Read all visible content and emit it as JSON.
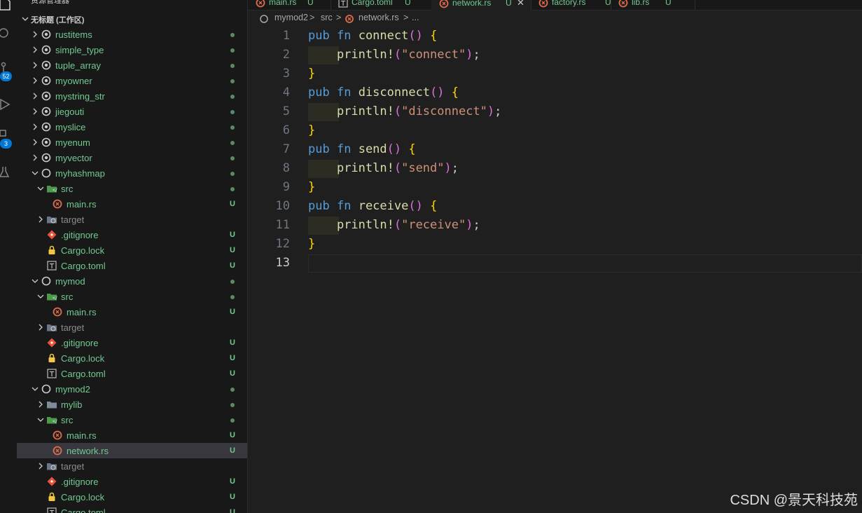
{
  "explorer": {
    "title": "资源管理器",
    "workspace": "无标题 (工作区)",
    "rows": [
      {
        "name": "rustitems",
        "type": "pkg",
        "status": "dot",
        "depth": 0,
        "chev": "right"
      },
      {
        "name": "simple_type",
        "type": "pkg",
        "status": "dot",
        "depth": 0,
        "chev": "right"
      },
      {
        "name": "tuple_array",
        "type": "pkg",
        "status": "dot",
        "depth": 0,
        "chev": "right"
      },
      {
        "name": "myowner",
        "type": "pkg",
        "status": "dot",
        "depth": 0,
        "chev": "right"
      },
      {
        "name": "mystring_str",
        "type": "pkg",
        "status": "dot",
        "depth": 0,
        "chev": "right"
      },
      {
        "name": "jiegouti",
        "type": "pkg",
        "status": "dot",
        "depth": 0,
        "chev": "right"
      },
      {
        "name": "myslice",
        "type": "pkg",
        "status": "dot",
        "depth": 0,
        "chev": "right"
      },
      {
        "name": "myenum",
        "type": "pkg",
        "status": "dot",
        "depth": 0,
        "chev": "right"
      },
      {
        "name": "myvector",
        "type": "pkg",
        "status": "dot",
        "depth": 0,
        "chev": "right"
      },
      {
        "name": "myhashmap",
        "type": "pkg-open",
        "status": "dot",
        "depth": 0,
        "chev": "down"
      },
      {
        "name": "src",
        "type": "src",
        "status": "dot",
        "depth": 1,
        "chev": "down"
      },
      {
        "name": "main.rs",
        "type": "rust",
        "status": "U",
        "depth": 2,
        "chev": ""
      },
      {
        "name": "target",
        "type": "target",
        "status": "",
        "depth": 1,
        "chev": "right"
      },
      {
        "name": ".gitignore",
        "type": "git",
        "status": "U",
        "depth": 1,
        "chev": ""
      },
      {
        "name": "Cargo.lock",
        "type": "lock",
        "status": "U",
        "depth": 1,
        "chev": ""
      },
      {
        "name": "Cargo.toml",
        "type": "toml",
        "status": "U",
        "depth": 1,
        "chev": ""
      },
      {
        "name": "mymod",
        "type": "pkg-open",
        "status": "dot",
        "depth": 0,
        "chev": "down"
      },
      {
        "name": "src",
        "type": "src",
        "status": "dot",
        "depth": 1,
        "chev": "down"
      },
      {
        "name": "main.rs",
        "type": "rust",
        "status": "U",
        "depth": 2,
        "chev": ""
      },
      {
        "name": "target",
        "type": "target",
        "status": "",
        "depth": 1,
        "chev": "right"
      },
      {
        "name": ".gitignore",
        "type": "git",
        "status": "U",
        "depth": 1,
        "chev": ""
      },
      {
        "name": "Cargo.lock",
        "type": "lock",
        "status": "U",
        "depth": 1,
        "chev": ""
      },
      {
        "name": "Cargo.toml",
        "type": "toml",
        "status": "U",
        "depth": 1,
        "chev": ""
      },
      {
        "name": "mymod2",
        "type": "pkg-open",
        "status": "dot",
        "depth": 0,
        "chev": "down"
      },
      {
        "name": "mylib",
        "type": "folder",
        "status": "dot",
        "depth": 1,
        "chev": "right"
      },
      {
        "name": "src",
        "type": "src",
        "status": "dot",
        "depth": 1,
        "chev": "down"
      },
      {
        "name": "main.rs",
        "type": "rust",
        "status": "U",
        "depth": 2,
        "chev": ""
      },
      {
        "name": "network.rs",
        "type": "rust",
        "status": "U",
        "depth": 2,
        "chev": "",
        "selected": true
      },
      {
        "name": "target",
        "type": "target",
        "status": "",
        "depth": 1,
        "chev": "right"
      },
      {
        "name": ".gitignore",
        "type": "git",
        "status": "U",
        "depth": 1,
        "chev": ""
      },
      {
        "name": "Cargo.lock",
        "type": "lock",
        "status": "U",
        "depth": 1,
        "chev": ""
      },
      {
        "name": "Cargo.toml",
        "type": "toml",
        "status": "U",
        "depth": 1,
        "chev": ""
      }
    ]
  },
  "activity": {
    "scm_badge": "52",
    "ext_badge": "3"
  },
  "tabs": [
    {
      "name": "main.rs",
      "mark": "U",
      "icon": "rust-icon"
    },
    {
      "name": "Cargo.toml",
      "mark": "U",
      "icon": "toml-icon"
    },
    {
      "name": "network.rs",
      "mark": "U",
      "icon": "rust-icon",
      "active": true
    },
    {
      "name": "factory.rs",
      "mark": "U",
      "icon": "rust-icon"
    },
    {
      "name": "lib.rs",
      "mark": "U",
      "icon": "rust-icon"
    }
  ],
  "breadcrumb": {
    "root": "mymod2",
    "sep1": ">",
    "folder": "src",
    "sep2": ">",
    "file": "network.rs",
    "sep3": ">",
    "more": "..."
  },
  "code": {
    "current_line": 13,
    "lines": [
      [
        [
          "kw",
          "pub"
        ],
        [
          "pl",
          " "
        ],
        [
          "kw",
          "fn"
        ],
        [
          "pl",
          " "
        ],
        [
          "fnn",
          "connect"
        ],
        [
          "br2",
          "()"
        ],
        [
          "pl",
          " "
        ],
        [
          "br1",
          "{"
        ]
      ],
      [
        [
          "ind",
          ""
        ],
        [
          "fnn",
          "println!"
        ],
        [
          "br2",
          "("
        ],
        [
          "str",
          "\"connect\""
        ],
        [
          "br2",
          ")"
        ],
        [
          "pl",
          ";"
        ]
      ],
      [
        [
          "br1",
          "}"
        ]
      ],
      [
        [
          "kw",
          "pub"
        ],
        [
          "pl",
          " "
        ],
        [
          "kw",
          "fn"
        ],
        [
          "pl",
          " "
        ],
        [
          "fnn",
          "disconnect"
        ],
        [
          "br2",
          "()"
        ],
        [
          "pl",
          " "
        ],
        [
          "br1",
          "{"
        ]
      ],
      [
        [
          "ind",
          ""
        ],
        [
          "fnn",
          "println!"
        ],
        [
          "br2",
          "("
        ],
        [
          "str",
          "\"disconnect\""
        ],
        [
          "br2",
          ")"
        ],
        [
          "pl",
          ";"
        ]
      ],
      [
        [
          "br1",
          "}"
        ]
      ],
      [
        [
          "kw",
          "pub"
        ],
        [
          "pl",
          " "
        ],
        [
          "kw",
          "fn"
        ],
        [
          "pl",
          " "
        ],
        [
          "fnn",
          "send"
        ],
        [
          "br2",
          "()"
        ],
        [
          "pl",
          " "
        ],
        [
          "br1",
          "{"
        ]
      ],
      [
        [
          "ind",
          ""
        ],
        [
          "fnn",
          "println!"
        ],
        [
          "br2",
          "("
        ],
        [
          "str",
          "\"send\""
        ],
        [
          "br2",
          ")"
        ],
        [
          "pl",
          ";"
        ]
      ],
      [
        [
          "br1",
          "}"
        ]
      ],
      [
        [
          "kw",
          "pub"
        ],
        [
          "pl",
          " "
        ],
        [
          "kw",
          "fn"
        ],
        [
          "pl",
          " "
        ],
        [
          "fnn",
          "receive"
        ],
        [
          "br2",
          "()"
        ],
        [
          "pl",
          " "
        ],
        [
          "br1",
          "{"
        ]
      ],
      [
        [
          "ind",
          ""
        ],
        [
          "fnn",
          "println!"
        ],
        [
          "br2",
          "("
        ],
        [
          "str",
          "\"receive\""
        ],
        [
          "br2",
          ")"
        ],
        [
          "pl",
          ";"
        ]
      ],
      [
        [
          "br1",
          "}"
        ]
      ],
      []
    ]
  },
  "watermark": "CSDN @景天科技苑",
  "colors": {
    "git_untracked": "#73c991",
    "accent": "#0078d4",
    "keyword": "#569cd6",
    "function": "#dcdcaa",
    "string": "#ce9178",
    "bracket_gold": "#ffd700",
    "bracket_purple": "#da70d6"
  }
}
